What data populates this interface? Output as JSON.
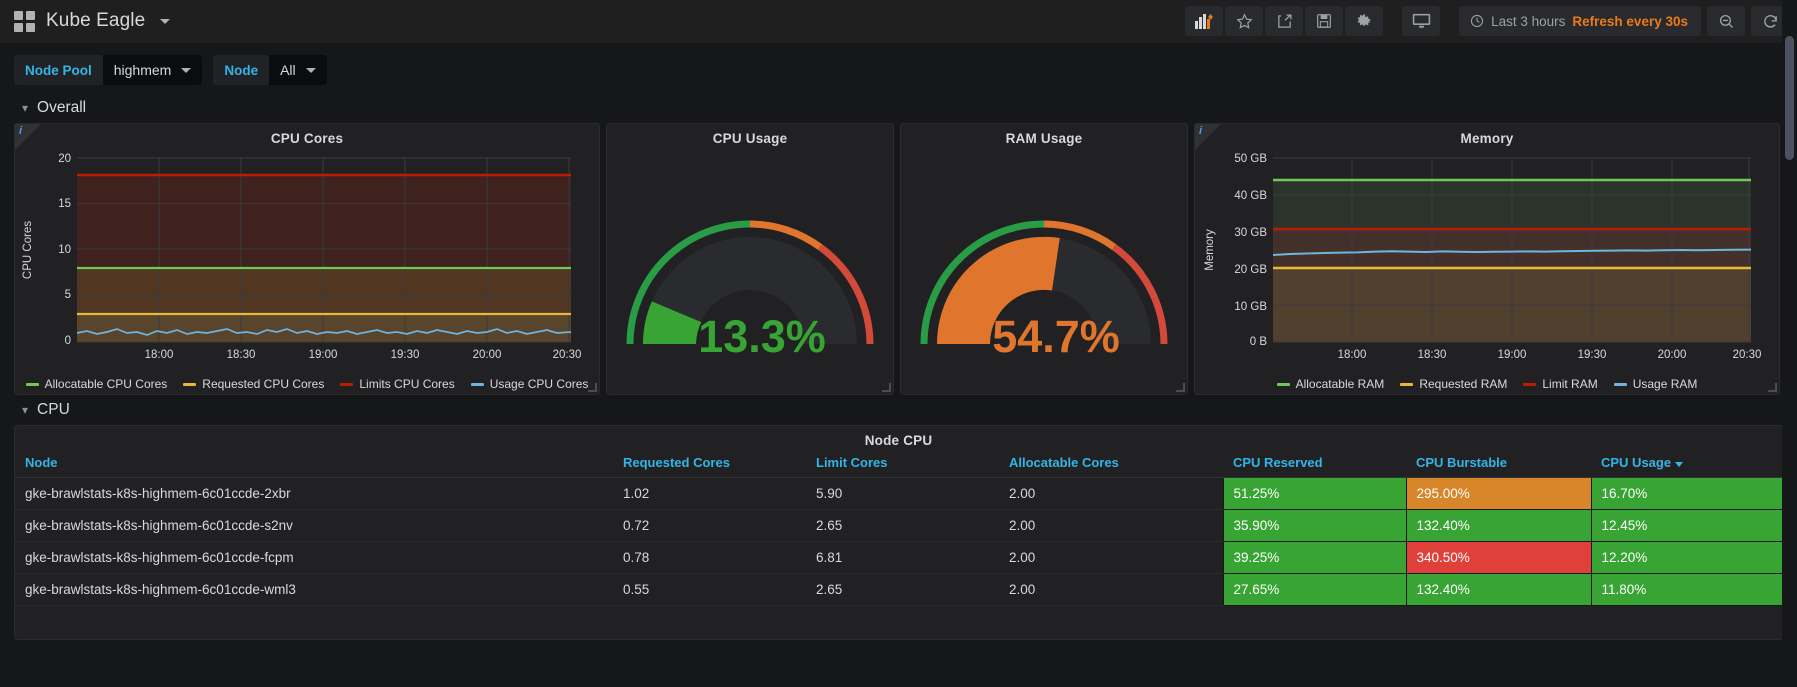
{
  "navbar": {
    "dashboard_title": "Kube Eagle",
    "menu_caret": "▾",
    "buttons": [
      {
        "name": "add-panel-button",
        "label": "Add panel"
      },
      {
        "name": "star-button",
        "label": "Mark as favorite"
      },
      {
        "name": "share-button",
        "label": "Share dashboard"
      },
      {
        "name": "save-button",
        "label": "Save dashboard"
      },
      {
        "name": "settings-button",
        "label": "Dashboard settings"
      },
      {
        "name": "tv-mode-button",
        "label": "Cycle view mode"
      }
    ],
    "time_range": "Last 3 hours",
    "refresh_interval": "Refresh every 30s",
    "zoom_out_label": "Zoom out time range",
    "refresh_label": "Refresh dashboard"
  },
  "variables": [
    {
      "label": "Node Pool",
      "value": "highmem"
    },
    {
      "label": "Node",
      "value": "All"
    }
  ],
  "rows": [
    {
      "title": "Overall",
      "collapsed": false
    },
    {
      "title": "CPU",
      "collapsed": false
    }
  ],
  "panels": {
    "cpu_cores": {
      "title": "CPU Cores",
      "info_badge": "i"
    },
    "cpu_usage_gauge": {
      "title": "CPU Usage",
      "value": "13.3%",
      "value_color": "#37a433"
    },
    "ram_usage_gauge": {
      "title": "RAM Usage",
      "value": "54.7%",
      "value_color": "#e0752d"
    },
    "memory": {
      "title": "Memory",
      "info_badge": "i"
    },
    "node_cpu_table": {
      "title": "Node CPU"
    }
  },
  "chart_data": [
    {
      "id": "cpu_cores",
      "type": "line",
      "title": "CPU Cores",
      "xlabel": "",
      "ylabel": "CPU Cores",
      "ylim": [
        0,
        20
      ],
      "yticks": [
        "0",
        "5",
        "10",
        "15",
        "20"
      ],
      "xticks": [
        "18:00",
        "18:30",
        "19:00",
        "19:30",
        "20:00",
        "20:30"
      ],
      "grid": true,
      "legend_position": "bottom",
      "series": [
        {
          "name": "Allocatable CPU Cores",
          "color": "#70c75a",
          "value": 8.0,
          "fill": true
        },
        {
          "name": "Requested CPU Cores",
          "color": "#eab839",
          "value": 3.0,
          "fill": true
        },
        {
          "name": "Limits CPU Cores",
          "color": "#bf1b00",
          "value": 18.0,
          "fill": true
        },
        {
          "name": "Usage CPU Cores",
          "color": "#6eb4e0",
          "value": 1.05,
          "fill": true
        }
      ]
    },
    {
      "id": "cpu_usage_gauge",
      "type": "gauge",
      "title": "CPU Usage",
      "value": 13.3,
      "unit": "%",
      "min": 0,
      "max": 100,
      "thresholds": [
        {
          "from": 0,
          "to": 50,
          "color": "#299c46"
        },
        {
          "from": 50,
          "to": 80,
          "color": "#e0752d"
        },
        {
          "from": 80,
          "to": 100,
          "color": "#d44a3a"
        }
      ]
    },
    {
      "id": "ram_usage_gauge",
      "type": "gauge",
      "title": "RAM Usage",
      "value": 54.7,
      "unit": "%",
      "min": 0,
      "max": 100,
      "thresholds": [
        {
          "from": 0,
          "to": 50,
          "color": "#299c46"
        },
        {
          "from": 50,
          "to": 80,
          "color": "#e0752d"
        },
        {
          "from": 80,
          "to": 100,
          "color": "#d44a3a"
        }
      ]
    },
    {
      "id": "memory",
      "type": "line",
      "title": "Memory",
      "xlabel": "",
      "ylabel": "Memory",
      "ylim": [
        0,
        50
      ],
      "yticks": [
        "0 B",
        "10 GB",
        "20 GB",
        "30 GB",
        "40 GB",
        "50 GB"
      ],
      "xticks": [
        "18:00",
        "18:30",
        "19:00",
        "19:30",
        "20:00",
        "20:30"
      ],
      "grid": true,
      "legend_position": "bottom",
      "series": [
        {
          "name": "Allocatable RAM",
          "color": "#70c75a",
          "value": 44.0,
          "fill": true
        },
        {
          "name": "Requested RAM",
          "color": "#eab839",
          "value": 20.0,
          "fill": true
        },
        {
          "name": "Limit RAM",
          "color": "#bf1b00",
          "value": 30.7,
          "fill": true
        },
        {
          "name": "Usage RAM",
          "color": "#6eb4e0",
          "value": 23.7,
          "fill": true
        }
      ]
    },
    {
      "id": "node_cpu_table",
      "type": "table",
      "title": "Node CPU",
      "columns": [
        "Node",
        "Requested Cores",
        "Limit Cores",
        "Allocatable Cores",
        "CPU Reserved",
        "CPU Burstable",
        "CPU Usage"
      ],
      "sorted_by": "CPU Usage",
      "sort_direction": "desc",
      "rows": [
        {
          "node": "gke-brawlstats-k8s-highmem-6c01ccde-2xbr",
          "requested_cores": "1.02",
          "limit_cores": "5.90",
          "allocatable_cores": "2.00",
          "cpu_reserved": "51.25%",
          "cpu_reserved_color": "#37a433",
          "cpu_burstable": "295.00%",
          "cpu_burstable_color": "#d8862a",
          "cpu_usage": "16.70%",
          "cpu_usage_color": "#37a433"
        },
        {
          "node": "gke-brawlstats-k8s-highmem-6c01ccde-s2nv",
          "requested_cores": "0.72",
          "limit_cores": "2.65",
          "allocatable_cores": "2.00",
          "cpu_reserved": "35.90%",
          "cpu_reserved_color": "#37a433",
          "cpu_burstable": "132.40%",
          "cpu_burstable_color": "#37a433",
          "cpu_usage": "12.45%",
          "cpu_usage_color": "#37a433"
        },
        {
          "node": "gke-brawlstats-k8s-highmem-6c01ccde-fcpm",
          "requested_cores": "0.78",
          "limit_cores": "6.81",
          "allocatable_cores": "2.00",
          "cpu_reserved": "39.25%",
          "cpu_reserved_color": "#37a433",
          "cpu_burstable": "340.50%",
          "cpu_burstable_color": "#e0403a",
          "cpu_usage": "12.20%",
          "cpu_usage_color": "#37a433"
        },
        {
          "node": "gke-brawlstats-k8s-highmem-6c01ccde-wml3",
          "requested_cores": "0.55",
          "limit_cores": "2.65",
          "allocatable_cores": "2.00",
          "cpu_reserved": "27.65%",
          "cpu_reserved_color": "#37a433",
          "cpu_burstable": "132.40%",
          "cpu_burstable_color": "#37a433",
          "cpu_usage": "11.80%",
          "cpu_usage_color": "#37a433"
        }
      ]
    }
  ]
}
